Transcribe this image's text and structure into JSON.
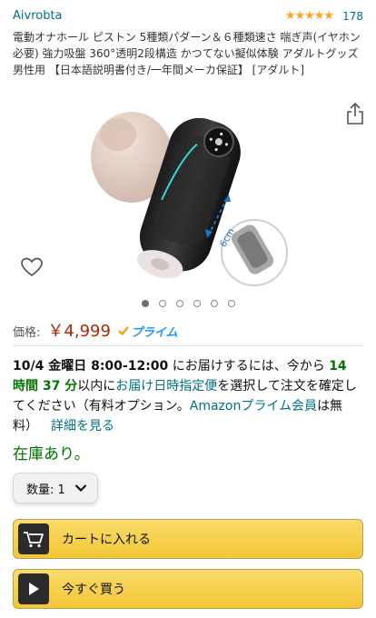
{
  "product": {
    "brand": "Aivrobta",
    "rating_stars": "★★★★★",
    "review_count": "178",
    "title": "電動オナホール ピストン 5種類パダーン＆６種類速さ 喘ぎ声(イヤホン必要) 強力吸盤 360°透明2段構造 かつてない擬似体験 アダルトグッズ 男性用 【日本語説明書付き/一年間メーカ保証】 [アダルト]",
    "image_indicator_count": 6,
    "image_indicator_active": 0,
    "image_label": "6cm"
  },
  "price": {
    "label": "価格:",
    "value": "￥4,999",
    "prime": "プライム"
  },
  "delivery": {
    "date": "10/4 金曜日 8:00-12:00",
    "text1": " にお届けするには、今から ",
    "countdown": "14 時間 37 分",
    "text2": "以内に",
    "link_scheduled": "お届け日時指定便",
    "text3": "を選択して注文を確定してください（有料オプション。",
    "link_prime": "Amazonプライム会員",
    "text4": "は無料）",
    "link_details": "詳細を見る"
  },
  "availability": "在庫あり。",
  "quantity": {
    "label": "数量: 1"
  },
  "buttons": {
    "add_to_cart": "カートに入れる",
    "buy_now": "今すぐ買う"
  },
  "colors": {
    "link": "#007185",
    "price": "#B12704",
    "stock": "#007600",
    "button": "#F3C634",
    "prime": "#1A98FF"
  },
  "icons": {
    "share": "share-icon",
    "wishlist": "heart-icon",
    "cart": "cart-icon",
    "play": "play-icon",
    "dropdown": "chevron-down-icon"
  }
}
